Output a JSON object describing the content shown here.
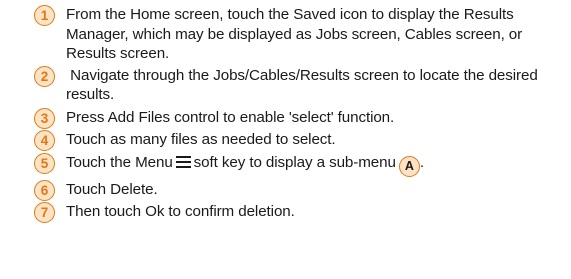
{
  "steps": [
    {
      "number": "1",
      "text": "From the Home screen, touch the Saved icon to display the Results Manager, which may be displayed as Jobs screen, Cables screen, or Results screen."
    },
    {
      "number": "2",
      "text": " Navigate through the Jobs/Cables/Results screen to locate the desired results."
    },
    {
      "number": "3",
      "text": "Press Add Files control to enable 'select' function."
    },
    {
      "number": "4",
      "text": "Touch as many files as needed to select."
    },
    {
      "number": "5",
      "text_before": "Touch the Menu",
      "icon": "menu-icon",
      "text_after": "soft key to display a sub-menu",
      "callout": "A",
      "text_end": "."
    },
    {
      "number": "6",
      "text": "Touch Delete."
    },
    {
      "number": "7",
      "text": "Then touch Ok to confirm deletion."
    }
  ],
  "colors": {
    "badge_fill": "#fbe3c3",
    "badge_border": "#e07a1a",
    "badge_number": "#e0781a",
    "text": "#1a1a1a"
  }
}
